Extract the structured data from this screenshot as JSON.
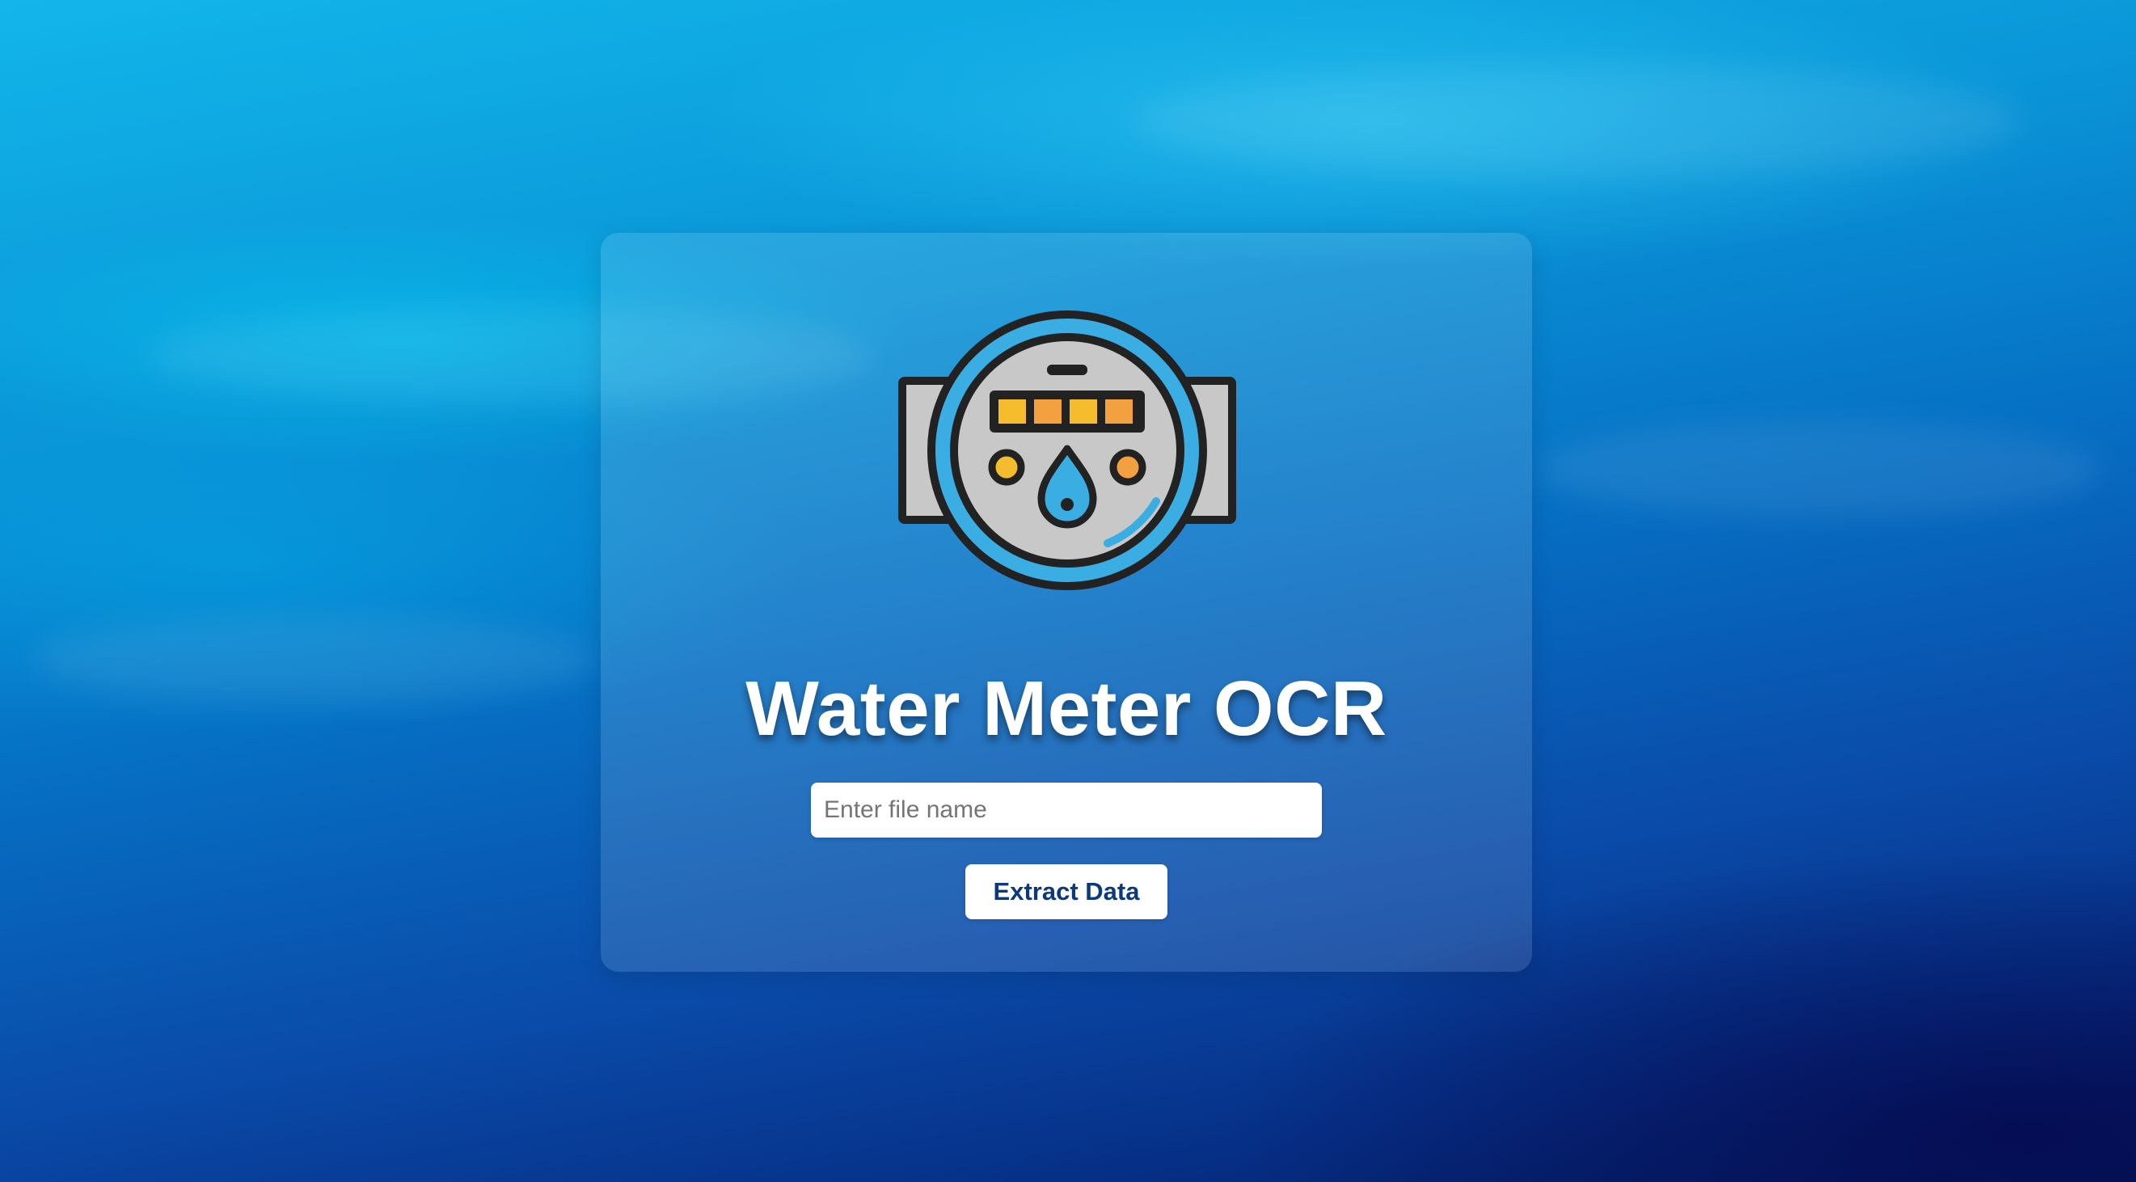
{
  "page": {
    "title": "Water Meter OCR",
    "logo_icon": "water-meter-icon"
  },
  "form": {
    "file_input": {
      "placeholder": "Enter file name",
      "value": ""
    },
    "extract_button_label": "Extract Data"
  },
  "colors": {
    "background_top": "#12b6ea",
    "background_bottom": "#041a5c",
    "card_overlay": "rgba(255,255,255,0.12)",
    "button_text": "#0a3a7a",
    "title_text": "#ffffff",
    "meter_ring": "#3aaee3",
    "meter_face": "#c8c8c8",
    "meter_digit_yellow": "#f5bd2e",
    "meter_digit_orange": "#f3a040",
    "outline": "#222222"
  }
}
